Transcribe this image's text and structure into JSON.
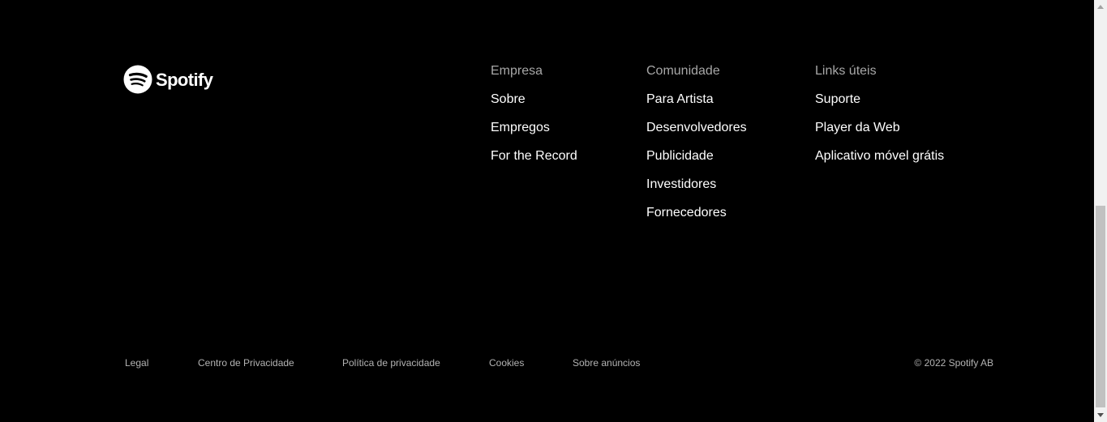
{
  "brand": {
    "name": "Spotify",
    "logo_color": "#ffffff"
  },
  "columns": [
    {
      "heading": "Empresa",
      "links": [
        "Sobre",
        "Empregos",
        "For the Record"
      ]
    },
    {
      "heading": "Comunidade",
      "links": [
        "Para Artista",
        "Desenvolvedores",
        "Publicidade",
        "Investidores",
        "Fornecedores"
      ]
    },
    {
      "heading": "Links úteis",
      "links": [
        "Suporte",
        "Player da Web",
        "Aplicativo móvel grátis"
      ]
    }
  ],
  "bottom_links": [
    "Legal",
    "Centro de Privacidade",
    "Política de privacidade",
    "Cookies",
    "Sobre anúncios"
  ],
  "copyright": "© 2022 Spotify AB",
  "colors": {
    "background": "#000000",
    "heading": "#a7a7a7",
    "link": "#ffffff",
    "muted": "#b3b3b3"
  }
}
